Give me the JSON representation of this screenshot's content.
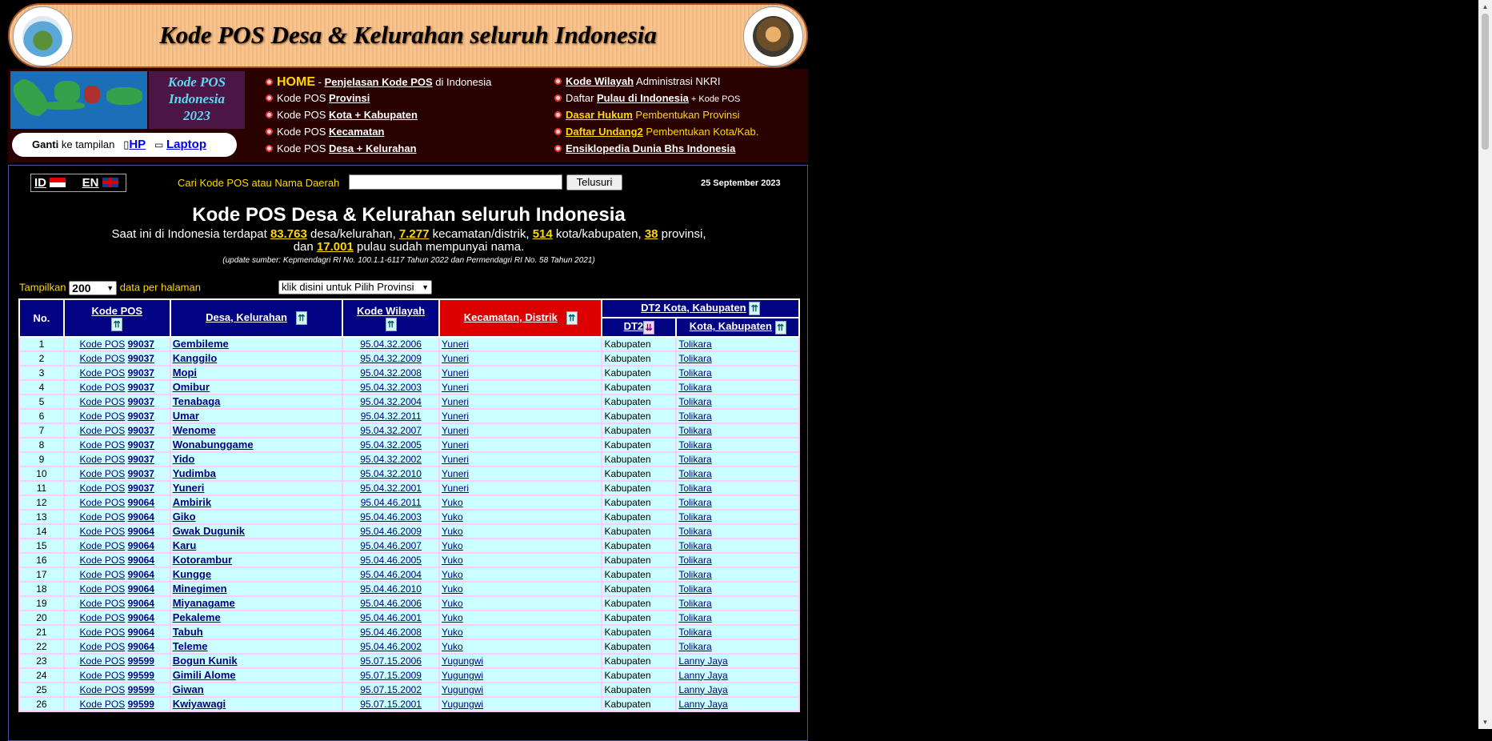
{
  "header": {
    "title": "Kode POS Desa & Kelurahan seluruh Indonesia"
  },
  "brand": {
    "line1": "Kode POS",
    "line2": "Indonesia",
    "line3": "2023"
  },
  "switch": {
    "label_bold": "Ganti",
    "label": "ke tampilan",
    "hp": "HP",
    "laptop": "Laptop"
  },
  "nav": {
    "col1": [
      {
        "home": "HOME",
        "pre": " - ",
        "link": "Penjelasan Kode POS",
        "post": " di Indonesia"
      },
      {
        "pre": "Kode POS ",
        "link": "Provinsi",
        "post": ""
      },
      {
        "pre": "Kode POS ",
        "link": "Kota + Kabupaten",
        "post": ""
      },
      {
        "pre": "Kode POS ",
        "link": "Kecamatan",
        "post": ""
      },
      {
        "pre": "Kode POS ",
        "link": "Desa + Kelurahan",
        "post": ""
      }
    ],
    "col2": [
      {
        "pre": "",
        "link": "Kode Wilayah",
        "post": " Administrasi NKRI"
      },
      {
        "pre": "Daftar ",
        "link": "Pulau di Indonesia",
        "post": " + Kode POS"
      },
      {
        "pre": "",
        "link": "Dasar Hukum",
        "post": " Pembentukan Provinsi"
      },
      {
        "pre": "",
        "link": "Daftar Undang2",
        "post": " Pembentukan Kota/Kab."
      },
      {
        "pre": "",
        "link": "Ensiklopedia Dunia Bhs Indonesia",
        "post": ""
      }
    ]
  },
  "lang": {
    "id": "ID",
    "en": "EN"
  },
  "search": {
    "label": "Cari Kode POS atau Nama Daerah",
    "value": "",
    "button": "Telusuri"
  },
  "date": "25 September 2023",
  "page": {
    "title": "Kode POS Desa & Kelurahan seluruh Indonesia",
    "desc_1": "Saat ini di Indonesia terdapat ",
    "n_desa": "83.763",
    "desc_2": " desa/kelurahan, ",
    "n_kec": "7.277",
    "desc_3": " kecamatan/distrik, ",
    "n_kota": "514",
    "desc_4": " kota/kabupaten, ",
    "n_prov": "38",
    "desc_5": " provinsi,",
    "desc_6": "dan ",
    "n_pulau": "17.001",
    "desc_7": " pulau sudah mempunyai nama.",
    "source": "(update sumber: Kepmendagri RI No. 100.1.1-6117 Tahun 2022 dan Permendagri RI No. 58 Tahun 2021)"
  },
  "controls": {
    "tampilkan": "Tampilkan",
    "per_page": "200",
    "per_page_suffix": "data per halaman",
    "provinsi": "klik disini untuk Pilih Provinsi"
  },
  "table": {
    "headers": {
      "no": "No.",
      "kodepos": "Kode POS",
      "desa": "Desa, Kelurahan",
      "kodewil": "Kode Wilayah",
      "kec": "Kecamatan, Distrik",
      "dt2group": "DT2 Kota, Kabupaten",
      "dt2": "DT2",
      "kota": "Kota, Kabupaten"
    },
    "prefix": "Kode POS",
    "rows": [
      {
        "no": "1",
        "kp": "99037",
        "desa": "Gembileme",
        "kw": "95.04.32.2006",
        "kec": "Yuneri",
        "dt2": "Kabupaten",
        "kota": "Tolikara"
      },
      {
        "no": "2",
        "kp": "99037",
        "desa": "Kanggilo",
        "kw": "95.04.32.2009",
        "kec": "Yuneri",
        "dt2": "Kabupaten",
        "kota": "Tolikara"
      },
      {
        "no": "3",
        "kp": "99037",
        "desa": "Mopi",
        "kw": "95.04.32.2008",
        "kec": "Yuneri",
        "dt2": "Kabupaten",
        "kota": "Tolikara"
      },
      {
        "no": "4",
        "kp": "99037",
        "desa": "Omibur",
        "kw": "95.04.32.2003",
        "kec": "Yuneri",
        "dt2": "Kabupaten",
        "kota": "Tolikara"
      },
      {
        "no": "5",
        "kp": "99037",
        "desa": "Tenabaga",
        "kw": "95.04.32.2004",
        "kec": "Yuneri",
        "dt2": "Kabupaten",
        "kota": "Tolikara"
      },
      {
        "no": "6",
        "kp": "99037",
        "desa": "Umar",
        "kw": "95.04.32.2011",
        "kec": "Yuneri",
        "dt2": "Kabupaten",
        "kota": "Tolikara"
      },
      {
        "no": "7",
        "kp": "99037",
        "desa": "Wenome",
        "kw": "95.04.32.2007",
        "kec": "Yuneri",
        "dt2": "Kabupaten",
        "kota": "Tolikara"
      },
      {
        "no": "8",
        "kp": "99037",
        "desa": "Wonabunggame",
        "kw": "95.04.32.2005",
        "kec": "Yuneri",
        "dt2": "Kabupaten",
        "kota": "Tolikara"
      },
      {
        "no": "9",
        "kp": "99037",
        "desa": "Yido",
        "kw": "95.04.32.2002",
        "kec": "Yuneri",
        "dt2": "Kabupaten",
        "kota": "Tolikara"
      },
      {
        "no": "10",
        "kp": "99037",
        "desa": "Yudimba",
        "kw": "95.04.32.2010",
        "kec": "Yuneri",
        "dt2": "Kabupaten",
        "kota": "Tolikara"
      },
      {
        "no": "11",
        "kp": "99037",
        "desa": "Yuneri",
        "kw": "95.04.32.2001",
        "kec": "Yuneri",
        "dt2": "Kabupaten",
        "kota": "Tolikara"
      },
      {
        "no": "12",
        "kp": "99064",
        "desa": "Ambirik",
        "kw": "95.04.46.2011",
        "kec": "Yuko",
        "dt2": "Kabupaten",
        "kota": "Tolikara"
      },
      {
        "no": "13",
        "kp": "99064",
        "desa": "Giko",
        "kw": "95.04.46.2003",
        "kec": "Yuko",
        "dt2": "Kabupaten",
        "kota": "Tolikara"
      },
      {
        "no": "14",
        "kp": "99064",
        "desa": "Gwak Dugunik",
        "kw": "95.04.46.2009",
        "kec": "Yuko",
        "dt2": "Kabupaten",
        "kota": "Tolikara"
      },
      {
        "no": "15",
        "kp": "99064",
        "desa": "Karu",
        "kw": "95.04.46.2007",
        "kec": "Yuko",
        "dt2": "Kabupaten",
        "kota": "Tolikara"
      },
      {
        "no": "16",
        "kp": "99064",
        "desa": "Kotorambur",
        "kw": "95.04.46.2005",
        "kec": "Yuko",
        "dt2": "Kabupaten",
        "kota": "Tolikara"
      },
      {
        "no": "17",
        "kp": "99064",
        "desa": "Kungge",
        "kw": "95.04.46.2004",
        "kec": "Yuko",
        "dt2": "Kabupaten",
        "kota": "Tolikara"
      },
      {
        "no": "18",
        "kp": "99064",
        "desa": "Minegimen",
        "kw": "95.04.46.2010",
        "kec": "Yuko",
        "dt2": "Kabupaten",
        "kota": "Tolikara"
      },
      {
        "no": "19",
        "kp": "99064",
        "desa": "Miyanagame",
        "kw": "95.04.46.2006",
        "kec": "Yuko",
        "dt2": "Kabupaten",
        "kota": "Tolikara"
      },
      {
        "no": "20",
        "kp": "99064",
        "desa": "Pekaleme",
        "kw": "95.04.46.2001",
        "kec": "Yuko",
        "dt2": "Kabupaten",
        "kota": "Tolikara"
      },
      {
        "no": "21",
        "kp": "99064",
        "desa": "Tabuh",
        "kw": "95.04.46.2008",
        "kec": "Yuko",
        "dt2": "Kabupaten",
        "kota": "Tolikara"
      },
      {
        "no": "22",
        "kp": "99064",
        "desa": "Teleme",
        "kw": "95.04.46.2002",
        "kec": "Yuko",
        "dt2": "Kabupaten",
        "kota": "Tolikara"
      },
      {
        "no": "23",
        "kp": "99599",
        "desa": "Bogun Kunik",
        "kw": "95.07.15.2006",
        "kec": "Yugungwi",
        "dt2": "Kabupaten",
        "kota": "Lanny Jaya"
      },
      {
        "no": "24",
        "kp": "99599",
        "desa": "Gimili Alome",
        "kw": "95.07.15.2009",
        "kec": "Yugungwi",
        "dt2": "Kabupaten",
        "kota": "Lanny Jaya"
      },
      {
        "no": "25",
        "kp": "99599",
        "desa": "Giwan",
        "kw": "95.07.15.2002",
        "kec": "Yugungwi",
        "dt2": "Kabupaten",
        "kota": "Lanny Jaya"
      },
      {
        "no": "26",
        "kp": "99599",
        "desa": "Kwiyawagi",
        "kw": "95.07.15.2001",
        "kec": "Yugungwi",
        "dt2": "Kabupaten",
        "kota": "Lanny Jaya"
      }
    ]
  }
}
